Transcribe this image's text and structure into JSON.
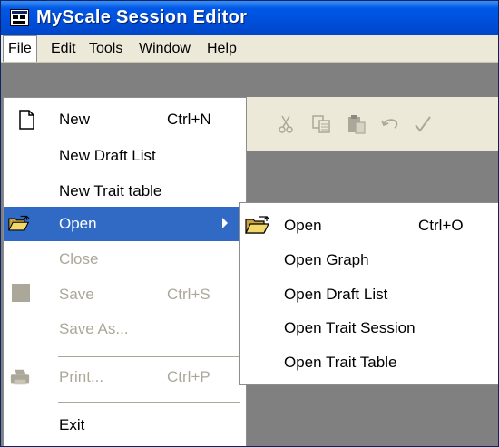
{
  "window": {
    "title": "MyScale Session Editor"
  },
  "menubar": {
    "items": [
      "File",
      "Edit",
      "Tools",
      "Window",
      "Help"
    ]
  },
  "file_menu": {
    "new": {
      "label": "New",
      "shortcut": "Ctrl+N"
    },
    "new_draft_list": {
      "label": "New Draft List"
    },
    "new_trait_table": {
      "label": "New Trait table"
    },
    "open": {
      "label": "Open"
    },
    "close": {
      "label": "Close"
    },
    "save": {
      "label": "Save",
      "shortcut": "Ctrl+S"
    },
    "save_as": {
      "label": "Save As..."
    },
    "print": {
      "label": "Print...",
      "shortcut": "Ctrl+P"
    },
    "exit": {
      "label": "Exit"
    }
  },
  "open_submenu": {
    "open": {
      "label": "Open",
      "shortcut": "Ctrl+O"
    },
    "open_graph": {
      "label": "Open Graph"
    },
    "open_draft_list": {
      "label": "Open Draft List"
    },
    "open_trait_session": {
      "label": "Open Trait Session"
    },
    "open_trait_table": {
      "label": "Open Trait Table"
    }
  },
  "toolbar_icons": [
    "cut-icon",
    "copy-icon",
    "paste-icon",
    "undo-icon",
    "check-icon"
  ],
  "colors": {
    "titlebar": "#0054e3",
    "selection": "#316ac5",
    "menubar": "#ece9d8",
    "disabled_text": "#aca899",
    "workspace": "#808080"
  }
}
